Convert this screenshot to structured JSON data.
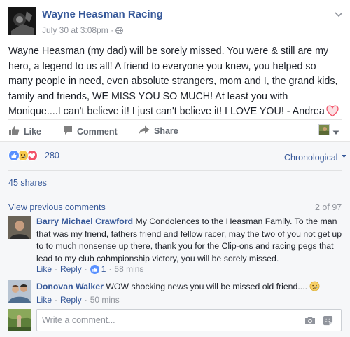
{
  "post": {
    "page_name": "Wayne Heasman Racing",
    "date": "July 30 at 3:08pm",
    "meta_separator": "·",
    "body": "Wayne Heasman (my dad) will be sorely missed. You were & still are my hero, a legend to us all! A friend to everyone you knew, you helped so many people in need, even absolute strangers, mom and I, the grand kids, family and friends, WE MISS YOU SO MUCH! At least you with Monique....I can't believe it! I just can't believe it! I LOVE YOU! - Andrea"
  },
  "actions": {
    "like": "Like",
    "comment": "Comment",
    "share": "Share"
  },
  "reactions": {
    "count": "280",
    "order": "Chronological"
  },
  "shares": "45 shares",
  "comments": {
    "view_previous": "View previous comments",
    "pagination": "2 of 97",
    "items": [
      {
        "author": "Barry Michael Crawford",
        "text": "My Condolences to the Heasman Family. To the man that was my friend, fathers friend and fellow racer, may the two of you not get up to to much nonsense up there, thank you for the Clip-ons and racing pegs that lead to my club cahmpionship victory, you will be sorely missed.",
        "like": "Like",
        "reply": "Reply",
        "like_count": "1",
        "time": "58 mins"
      },
      {
        "author": "Donovan Walker",
        "text": "WOW shocking news you will be missed old friend....",
        "like": "Like",
        "reply": "Reply",
        "time": "50 mins"
      }
    ]
  },
  "composer": {
    "placeholder": "Write a comment..."
  },
  "colors": {
    "link": "#365899",
    "muted": "#90949c",
    "like_blue": "#5890ff",
    "heart_pink": "#f25268"
  },
  "icons": [
    "globe-icon",
    "chevron-down-icon",
    "thumbs-up-icon",
    "comment-icon",
    "share-arrow-icon",
    "like-reaction-icon",
    "sad-reaction-icon",
    "love-reaction-icon",
    "heart-emoji-icon",
    "sad-emoji-icon",
    "camera-icon",
    "sticker-icon"
  ]
}
